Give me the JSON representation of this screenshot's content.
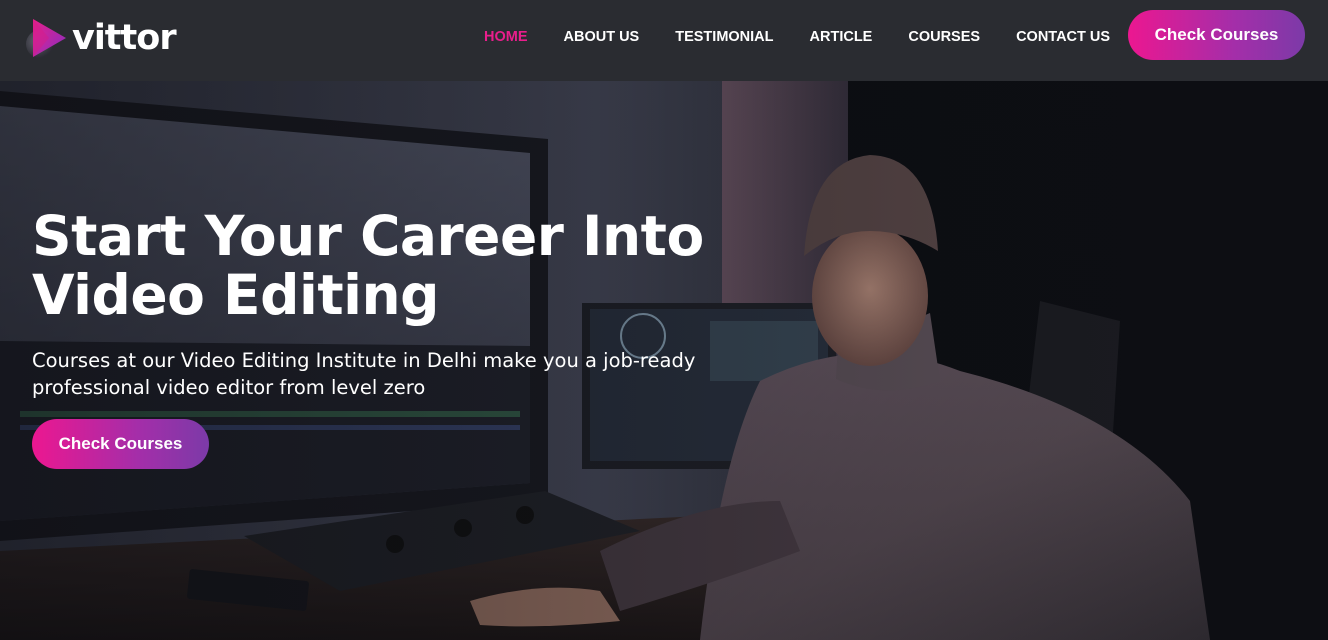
{
  "brand": {
    "name": "vittor",
    "logo_icon": "play-logo-icon",
    "accent_color": "#e91e8c",
    "gradient_end_color": "#7c3aa8"
  },
  "nav": {
    "items": [
      {
        "label": "HOME",
        "active": true
      },
      {
        "label": "ABOUT US",
        "active": false
      },
      {
        "label": "TESTIMONIAL",
        "active": false
      },
      {
        "label": "ARTICLE",
        "active": false
      },
      {
        "label": "COURSES",
        "active": false
      },
      {
        "label": "CONTACT US",
        "active": false
      }
    ],
    "cta_label": "Check Courses"
  },
  "hero": {
    "title": "Start Your Career Into Video Editing",
    "subtitle": "Courses at our Video Editing Institute in Delhi make you a job-ready professional video editor from level zero",
    "cta_label": "Check Courses",
    "background": "video-editor-studio-photo"
  }
}
